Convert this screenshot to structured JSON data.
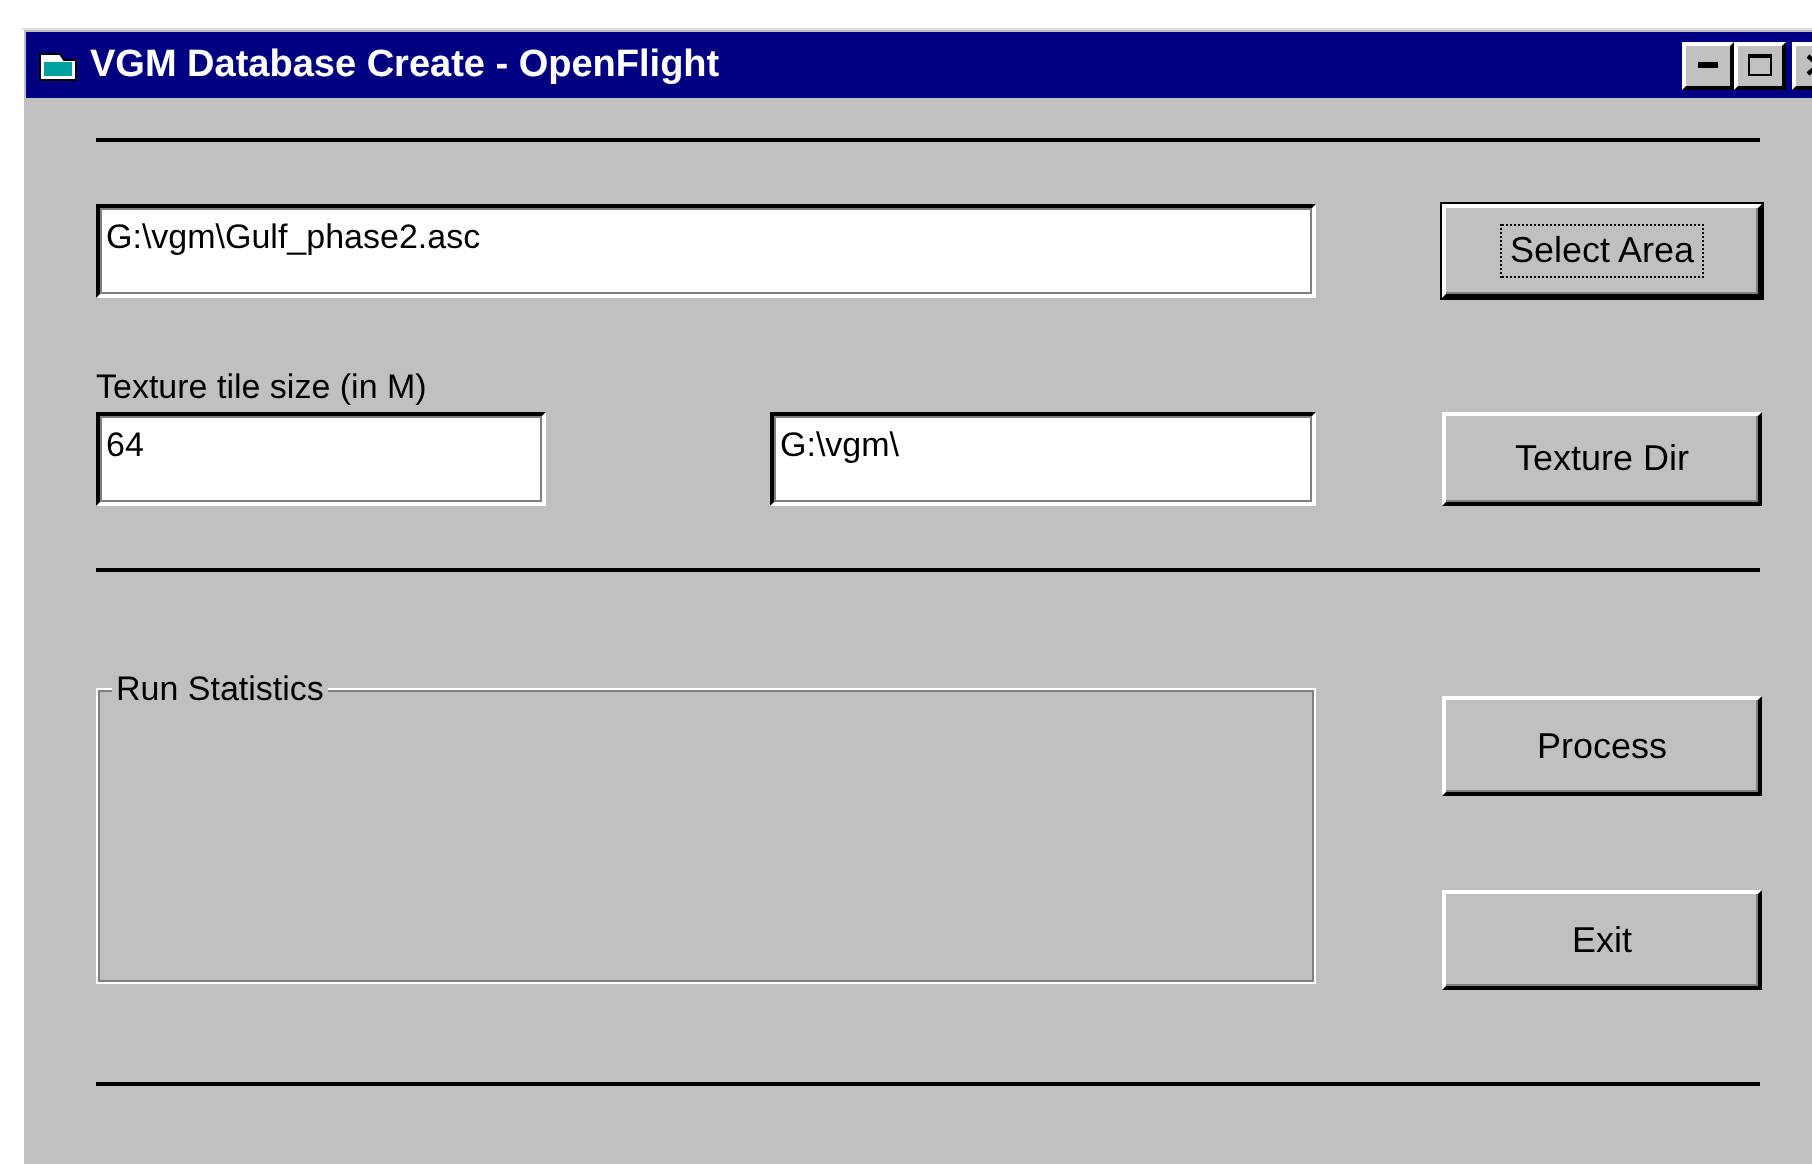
{
  "window": {
    "title": "VGM Database Create - OpenFlight",
    "controls": [
      {
        "kind": "minimize"
      },
      {
        "kind": "maximize"
      },
      {
        "kind": "close"
      }
    ]
  },
  "area_field": {
    "value": "G:\\vgm\\Gulf_phase2.asc"
  },
  "select_area_button": {
    "label": "Select Area",
    "default": true
  },
  "texture_size": {
    "label": "Texture tile size (in M)",
    "value": "64"
  },
  "texture_dir_field": {
    "value": "G:\\vgm\\"
  },
  "texture_dir_button": {
    "label": "Texture Dir",
    "default": false
  },
  "run_statistics": {
    "title": "Run Statistics"
  },
  "process_button": {
    "label": "Process",
    "default": false
  },
  "exit_button": {
    "label": "Exit",
    "default": false
  }
}
